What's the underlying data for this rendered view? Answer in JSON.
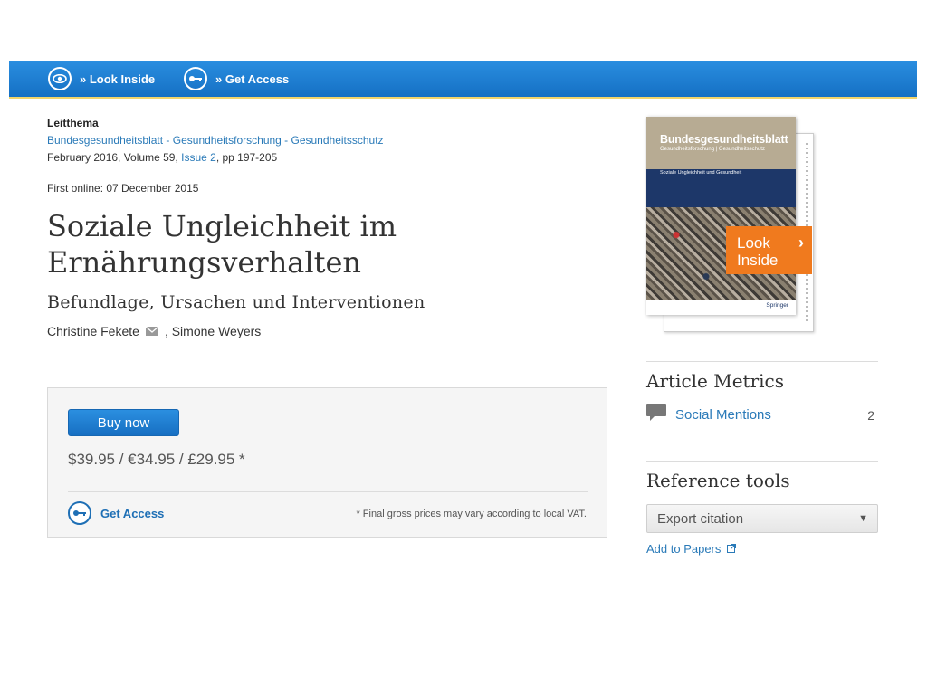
{
  "toolbar": {
    "look_inside": "» Look Inside",
    "get_access": "» Get Access"
  },
  "article": {
    "category": "Leitthema",
    "journal": "Bundesgesundheitsblatt - Gesundheitsforschung - Gesundheitsschutz",
    "issue_prefix": "February 2016, Volume 59,",
    "issue_link": "Issue 2",
    "pages": ", pp 197-205",
    "first_online": "First online: 07 December 2015",
    "title": "Soziale Ungleichheit im Ernährungsverhalten",
    "subtitle": "Befundlage, Ursachen und Interventionen",
    "author1": "Christine Fekete",
    "author_sep": ",",
    "author2": "Simone Weyers"
  },
  "buybox": {
    "buy_label": "Buy now",
    "prices": "$39.95 / €34.95 / £29.95 *",
    "get_access": "Get Access",
    "vat_note": "* Final gross prices may vary according to local VAT."
  },
  "cover": {
    "journal_title": "Bundesgesundheitsblatt",
    "journal_sub": "Gesundheitsforschung | Gesundheitsschutz",
    "band_text": "Soziale Ungleichheit und Gesundheit",
    "publisher": "Springer",
    "look_label_1": "Look",
    "look_label_2": "Inside"
  },
  "sidebar": {
    "metrics_heading": "Article Metrics",
    "social_label": "Social Mentions",
    "social_count": "2",
    "tools_heading": "Reference tools",
    "export_label": "Export citation",
    "papers_label": "Add to Papers"
  },
  "colors": {
    "toolbar_blue": "#1f7fd4",
    "link_blue": "#2a7ab8",
    "look_inside_orange": "#f07a1e",
    "cover_navy": "#1d3769"
  },
  "icons": {
    "look_inside": "eye-icon",
    "get_access": "key-icon",
    "author_email": "mail-icon",
    "social": "speech-bubble-icon",
    "export": "caret-down-icon",
    "papers": "external-link-icon"
  }
}
